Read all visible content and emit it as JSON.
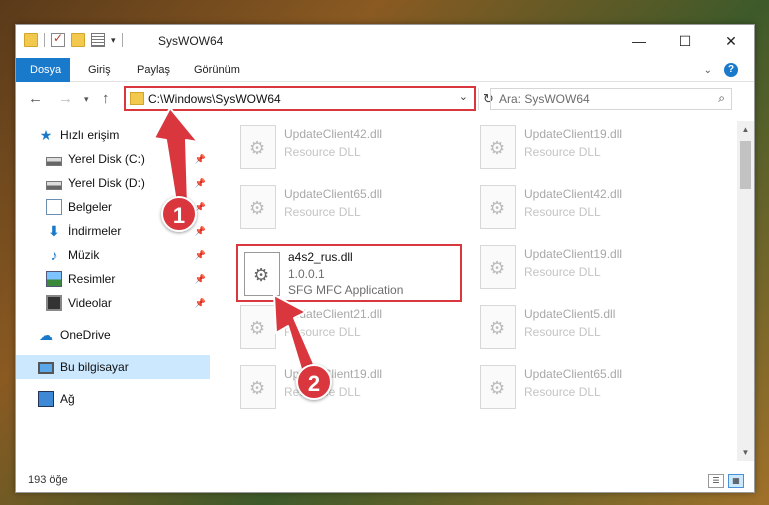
{
  "window": {
    "title": "SysWOW64",
    "controls": {
      "minimize": "—",
      "maximize": "☐",
      "close": "✕"
    }
  },
  "ribbon": {
    "tabs": [
      {
        "label": "Dosya",
        "active": true
      },
      {
        "label": "Giriş"
      },
      {
        "label": "Paylaş"
      },
      {
        "label": "Görünüm"
      }
    ],
    "help_label": "?"
  },
  "address": {
    "path": "C:\\Windows\\SysWOW64",
    "search_placeholder": "Ara: SysWOW64"
  },
  "nav": {
    "items": [
      {
        "label": "Hızlı erişim",
        "icon": "star-icon"
      },
      {
        "label": "Yerel Disk (C:)",
        "icon": "disk-icon",
        "pinned": true
      },
      {
        "label": "Yerel Disk (D:)",
        "icon": "disk-icon",
        "pinned": true
      },
      {
        "label": "Belgeler",
        "icon": "document-icon",
        "pinned": true
      },
      {
        "label": "İndirmeler",
        "icon": "download-icon",
        "pinned": true
      },
      {
        "label": "Müzik",
        "icon": "music-icon",
        "pinned": true
      },
      {
        "label": "Resimler",
        "icon": "picture-icon",
        "pinned": true
      },
      {
        "label": "Videolar",
        "icon": "video-icon",
        "pinned": true
      },
      {
        "label": "OneDrive",
        "icon": "cloud-icon"
      },
      {
        "label": "Bu bilgisayar",
        "icon": "computer-icon",
        "selected": true
      },
      {
        "label": "Ağ",
        "icon": "network-icon"
      }
    ]
  },
  "files": {
    "left": [
      {
        "name": "UpdateClient42.dll",
        "desc": "Resource DLL"
      },
      {
        "name": "UpdateClient65.dll",
        "desc": "Resource DLL"
      },
      {
        "name": "UpdateClient21.dll",
        "desc": "Resource DLL"
      },
      {
        "name": "UpdateClient19.dll",
        "desc": "Resource DLL"
      }
    ],
    "right": [
      {
        "name": "UpdateClient19.dll",
        "desc": "Resource DLL"
      },
      {
        "name": "UpdateClient42.dll",
        "desc": "Resource DLL"
      },
      {
        "name": "UpdateClient19.dll",
        "desc": "Resource DLL"
      },
      {
        "name": "UpdateClient5.dll",
        "desc": "Resource DLL"
      },
      {
        "name": "UpdateClient65.dll",
        "desc": "Resource DLL"
      }
    ],
    "highlighted": {
      "name": "a4s2_rus.dll",
      "version": "1.0.0.1",
      "desc": "SFG MFC Application"
    }
  },
  "status": {
    "count": "193 öğe"
  },
  "callouts": [
    "1",
    "2"
  ],
  "colors": {
    "accent": "#1979ca",
    "annotation": "#d9363e",
    "selected": "#cce8ff"
  }
}
